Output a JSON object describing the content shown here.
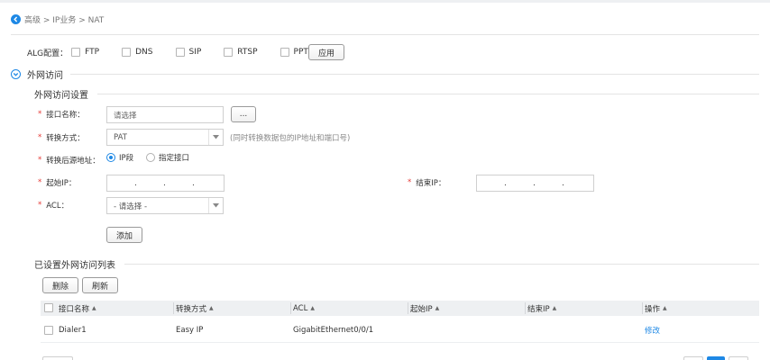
{
  "breadcrumb": {
    "text": "高级 > IP业务 > NAT"
  },
  "alg": {
    "label": "ALG配置：",
    "options": [
      "FTP",
      "DNS",
      "SIP",
      "RTSP",
      "PPTP"
    ],
    "apply_label": "应用"
  },
  "section": {
    "title": "外网访问"
  },
  "settings": {
    "title": "外网访问设置",
    "required_mark": "*",
    "interface_label": "接口名称：",
    "interface_placeholder": "请选择",
    "browse_label": "...",
    "mode_label": "转换方式：",
    "mode_value": "PAT",
    "mode_hint": "(同时转换数据包的IP地址和端口号)",
    "source_label": "转换后源地址：",
    "source_opt_ip": "IP段",
    "source_opt_if": "指定接口",
    "start_ip_label": "起始IP：",
    "end_ip_label": "结束IP：",
    "ip_dot": ".",
    "acl_label": "ACL：",
    "acl_value": "- 请选择 -",
    "add_label": "添加"
  },
  "list": {
    "title": "已设置外网访问列表",
    "delete_label": "删除",
    "refresh_label": "刷新",
    "sort_mark": "▲",
    "columns": [
      "接口名称",
      "转换方式",
      "ACL",
      "起始IP",
      "结束IP",
      "操作"
    ],
    "rows": [
      {
        "interface": "Dialer1",
        "mode": "Easy IP",
        "acl": "GigabitEthernet0/0/1",
        "start_ip": "",
        "end_ip": "",
        "action": "修改"
      }
    ]
  },
  "colors": {
    "accent": "#1e88e5",
    "required": "#e53935"
  },
  "icons": {
    "back": "chevron-left-circle-icon",
    "collapse": "chevron-down-circle-icon",
    "dropdown": "caret-down-icon"
  }
}
